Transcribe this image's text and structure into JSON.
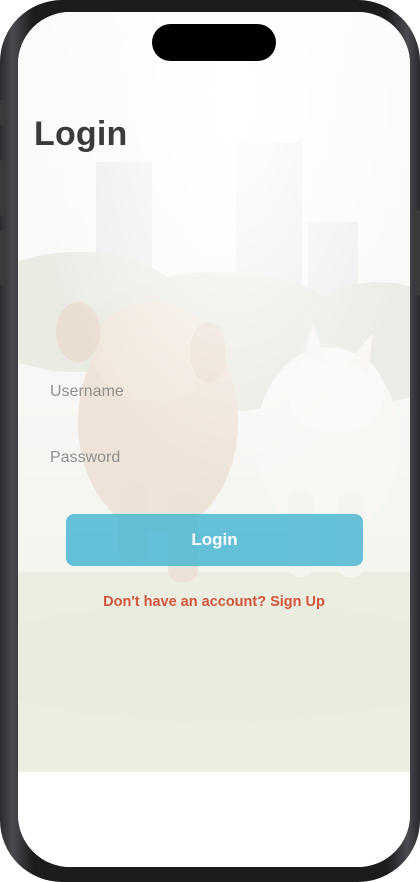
{
  "screen": {
    "title": "Login"
  },
  "form": {
    "username_placeholder": "Username",
    "username_value": "",
    "password_placeholder": "Password",
    "password_value": "",
    "login_label": "Login",
    "signup_label": "Don't have an account? Sign Up"
  },
  "colors": {
    "login_button": "#44B4D2",
    "signup_link": "#D3553B",
    "title_text": "#3B3B3B"
  },
  "background": {
    "image_subject": "dogs-running-in-park-photo"
  }
}
